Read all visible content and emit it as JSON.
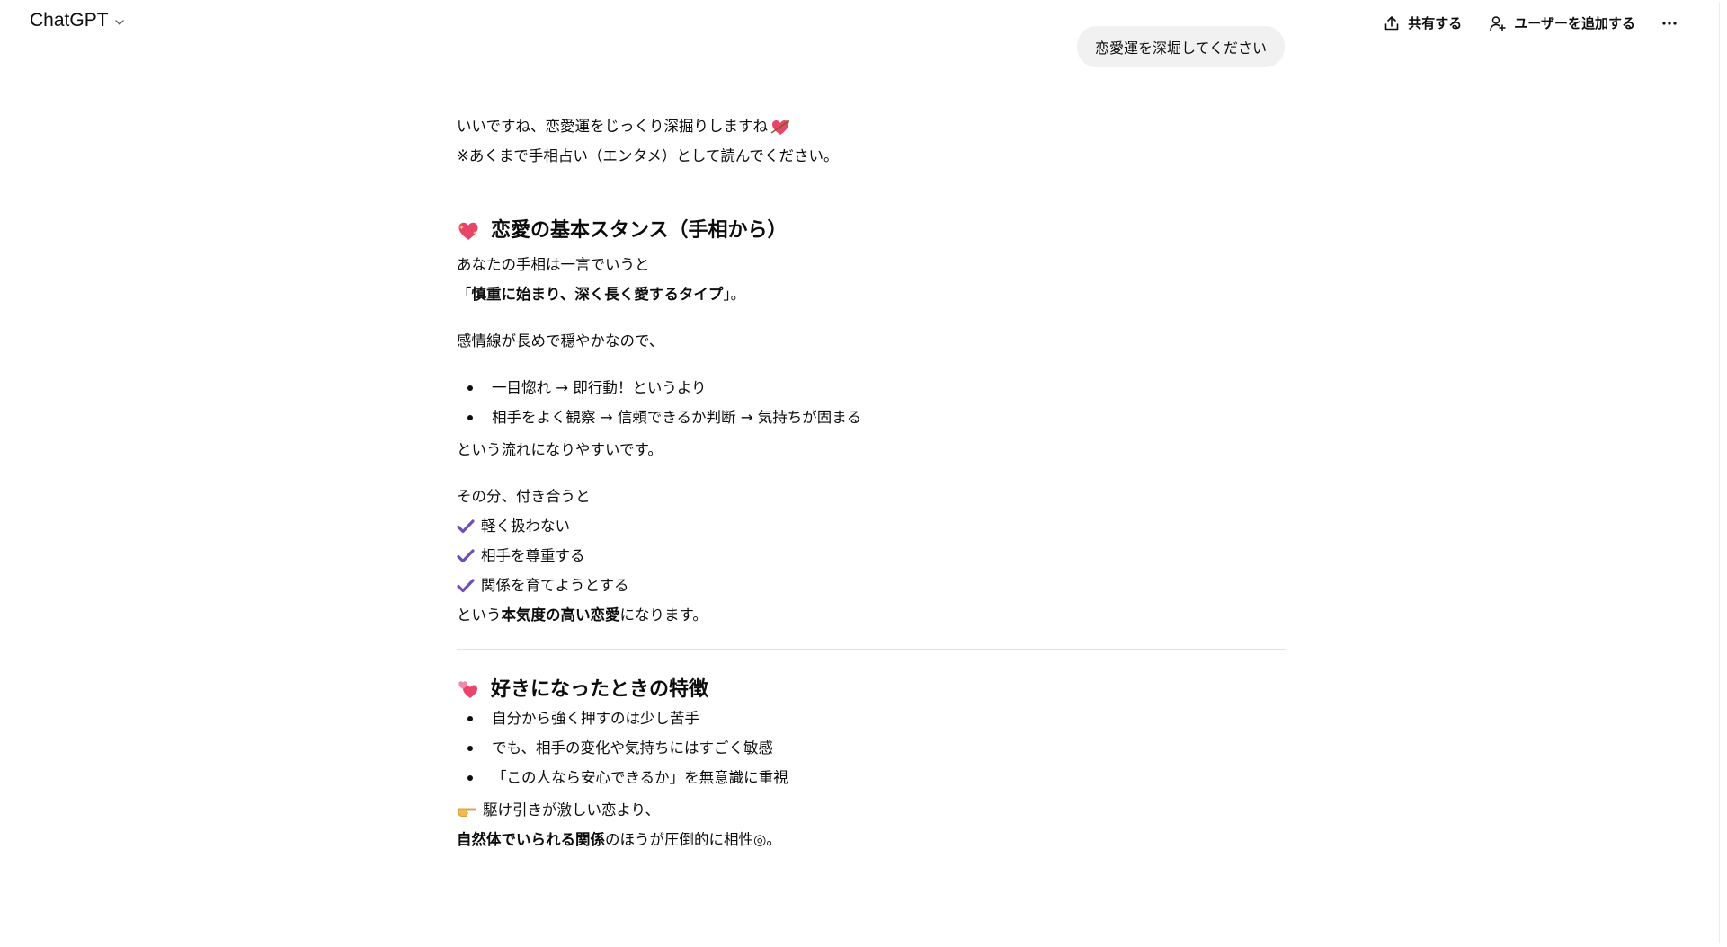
{
  "header": {
    "model_label": "ChatGPT",
    "share_label": "共有する",
    "add_user_label": "ユーザーを追加する"
  },
  "user_message": "恋愛運を深堀してください",
  "intro": {
    "line1": "いいですね、恋愛運をじっくり深掘りしますね",
    "line2": "※あくまで手相占い（エンタメ）として読んでください。"
  },
  "section1": {
    "heading": "恋愛の基本スタンス（手相から）",
    "p1": "あなたの手相は一言でいうと",
    "quote_open": "「",
    "quote_bold": "慎重に始まり、深く長く愛するタイプ",
    "quote_close": "」。",
    "p3": "感情線が長めで穏やかなので、",
    "bullets": [
      "一目惚れ → 即行動！というより",
      "相手をよく観察 → 信頼できるか判断 → 気持ちが固まる"
    ],
    "p4": "という流れになりやすいです。",
    "p5": "その分、付き合うと",
    "checks": [
      "軽く扱わない",
      "相手を尊重する",
      "関係を育てようとする"
    ],
    "closing_pre": "という",
    "closing_bold": "本気度の高い恋愛",
    "closing_post": "になります。"
  },
  "section2": {
    "heading": "好きになったときの特徴",
    "bullets": [
      "自分から強く押すのは少し苦手",
      "でも、相手の変化や気持ちにはすごく敏感",
      "「この人なら安心できるか」を無意識に重視"
    ],
    "point_line": "駆け引きが激しい恋より、",
    "last_bold": "自然体でいられる関係",
    "last_rest": "のほうが圧倒的に相性◎。"
  },
  "icons": {
    "accent_check": "#6e4fb8",
    "heart_pink": "#e8456b"
  }
}
